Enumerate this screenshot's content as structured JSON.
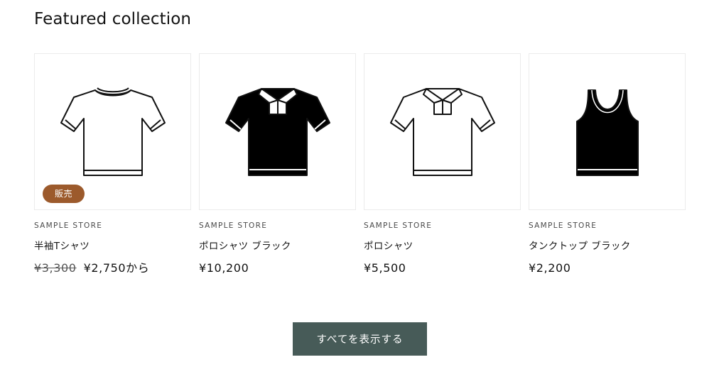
{
  "section": {
    "title": "Featured collection"
  },
  "colors": {
    "badge_bg": "#9c5a2c",
    "button_bg": "#475b58"
  },
  "products": [
    {
      "vendor": "SAMPLE STORE",
      "title": "半袖Tシャツ",
      "price_compare": "¥3,300",
      "price": "¥2,750から",
      "badge": "販売",
      "image_icon": "tshirt-white-icon"
    },
    {
      "vendor": "SAMPLE STORE",
      "title": "ポロシャツ ブラック",
      "price_compare": "",
      "price": "¥10,200",
      "badge": "",
      "image_icon": "polo-black-icon"
    },
    {
      "vendor": "SAMPLE STORE",
      "title": "ポロシャツ",
      "price_compare": "",
      "price": "¥5,500",
      "badge": "",
      "image_icon": "polo-white-icon"
    },
    {
      "vendor": "SAMPLE STORE",
      "title": "タンクトップ ブラック",
      "price_compare": "",
      "price": "¥2,200",
      "badge": "",
      "image_icon": "tanktop-black-icon"
    }
  ],
  "view_all": {
    "label": "すべてを表示する"
  }
}
